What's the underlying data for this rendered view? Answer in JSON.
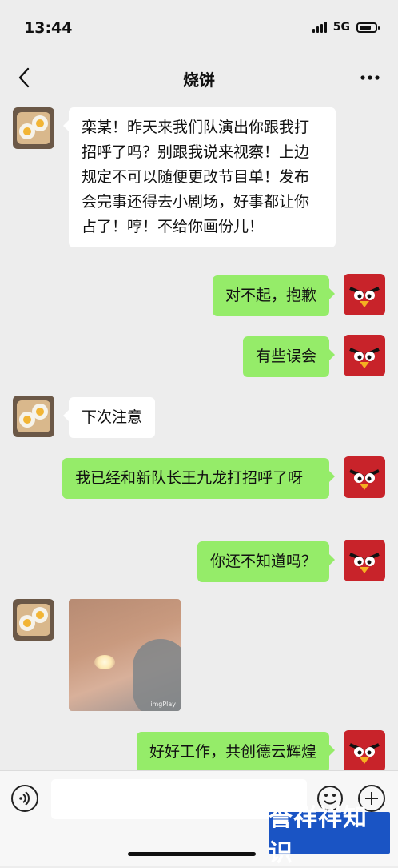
{
  "status": {
    "time": "13:44",
    "network": "5G"
  },
  "header": {
    "title": "烧饼"
  },
  "messages": [
    {
      "side": "left",
      "text": "栾某！昨天来我们队演出你跟我打招呼了吗？别跟我说来视察！上边规定不可以随便更改节目单！发布会完事还得去小剧场，好事都让你占了！哼！不给你画份儿！"
    },
    {
      "side": "right",
      "text": "对不起，抱歉"
    },
    {
      "side": "right",
      "text": "有些误会"
    },
    {
      "side": "left",
      "text": "下次注意"
    },
    {
      "side": "right",
      "text": "我已经和新队长王九龙打招呼了呀"
    },
    {
      "side": "right",
      "text": "你还不知道吗？"
    },
    {
      "side": "left",
      "type": "image",
      "watermark": "imgPlay"
    },
    {
      "side": "right",
      "text": "好好工作，共创德云辉煌"
    }
  ],
  "input": {
    "placeholder": ""
  },
  "icons": {
    "back": "back-arrow-icon",
    "more": "more-dots-icon",
    "voice": "voice-icon",
    "emoji": "emoji-icon",
    "plus": "plus-icon"
  },
  "watermark": {
    "text": "誉祥祥知识"
  },
  "colors": {
    "sent_bubble": "#95ec69",
    "received_bubble": "#ffffff",
    "background": "#ededed"
  }
}
